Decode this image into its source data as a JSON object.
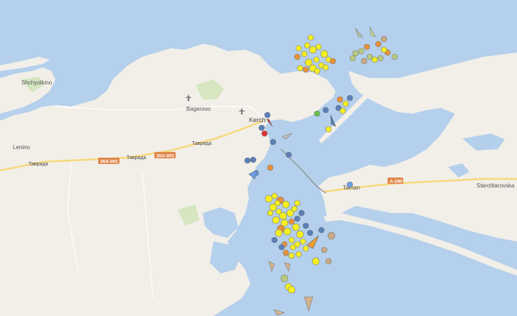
{
  "map": {
    "colors": {
      "water": "#b5d0ec",
      "land": "#f2efe9",
      "green": "#d5e6c0",
      "road": "#f7d87a",
      "shield": "#e0874c"
    },
    "labels": {
      "shchyolkino": "Shchyolkino",
      "leninc": "Lenino",
      "bagerovo": "Bagerovo",
      "kerch": "Kerch",
      "taman": "Taman",
      "starotitarovskaya": "Starotitarovska",
      "road_tavrida_1": "Таврида",
      "road_tavrida_2": "Таврида",
      "road_tavrida_3": "Таврида"
    },
    "shields": {
      "s1": "35A-001",
      "s2": "35A-001",
      "s3": "A-290"
    },
    "icons": {
      "airport": "airport-icon",
      "vessel": "vessel-marker-icon"
    }
  }
}
